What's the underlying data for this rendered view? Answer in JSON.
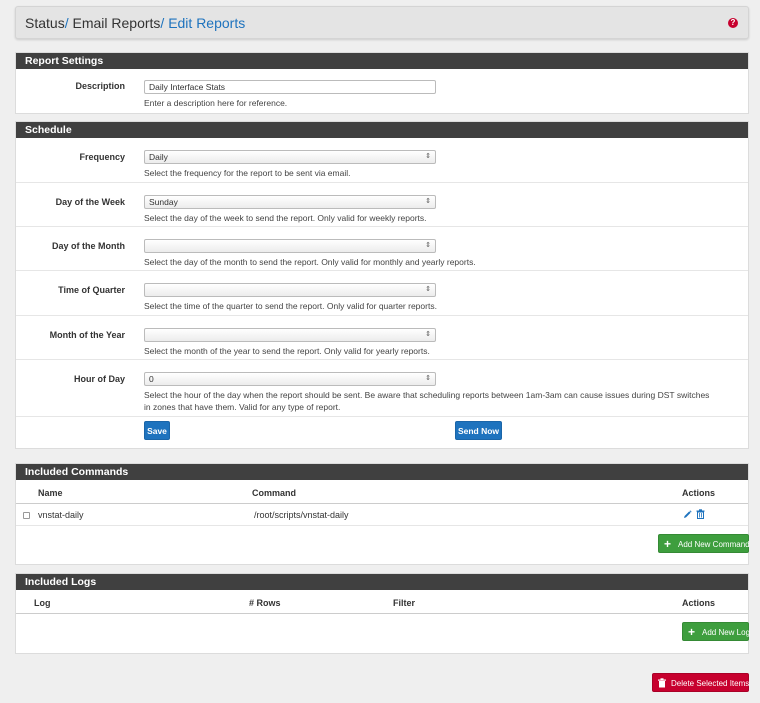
{
  "breadcrumb": {
    "part1": "Status",
    "sep1": "/",
    "part2": "Email Reports",
    "sep2": "/",
    "part3": "Edit Reports"
  },
  "help_glyph": "?",
  "report_settings": {
    "title": "Report Settings",
    "description": {
      "label": "Description",
      "value": "Daily Interface Stats",
      "help": "Enter a description here for reference."
    }
  },
  "schedule": {
    "title": "Schedule",
    "frequency": {
      "label": "Frequency",
      "value": "Daily",
      "help": "Select the frequency for the report to be sent via email."
    },
    "day_of_week": {
      "label": "Day of the Week",
      "value": "Sunday",
      "help": "Select the day of the week to send the report. Only valid for weekly reports."
    },
    "day_of_month": {
      "label": "Day of the Month",
      "value": "",
      "help": "Select the day of the month to send the report. Only valid for monthly and yearly reports."
    },
    "time_of_quarter": {
      "label": "Time of Quarter",
      "value": "",
      "help": "Select the time of the quarter to send the report. Only valid for quarter reports."
    },
    "month_of_year": {
      "label": "Month of the Year",
      "value": "",
      "help": "Select the month of the year to send the report. Only valid for yearly reports."
    },
    "hour_of_day": {
      "label": "Hour of Day",
      "value": "0",
      "help_line1": "Select the hour of the day when the report should be sent. Be aware that scheduling reports between 1am-3am can cause issues during DST switches",
      "help_line2": "in zones that have them. Valid for any type of report."
    },
    "save_label": "Save",
    "send_now_label": "Send Now"
  },
  "commands": {
    "title": "Included Commands",
    "columns": [
      "Name",
      "Command",
      "Actions"
    ],
    "rows": [
      {
        "name": "vnstat-daily",
        "command": "/root/scripts/vnstat-daily"
      }
    ],
    "add_label": "Add New Command"
  },
  "logs": {
    "title": "Included Logs",
    "columns": [
      "Log",
      "# Rows",
      "Filter",
      "Actions"
    ],
    "add_label": "Add New Log"
  },
  "delete_label": "Delete Selected Items",
  "colors": {
    "header_bar": "#404040",
    "link_blue": "#1e73be",
    "button_green": "#3e9e3e",
    "button_red": "#c7002e"
  }
}
